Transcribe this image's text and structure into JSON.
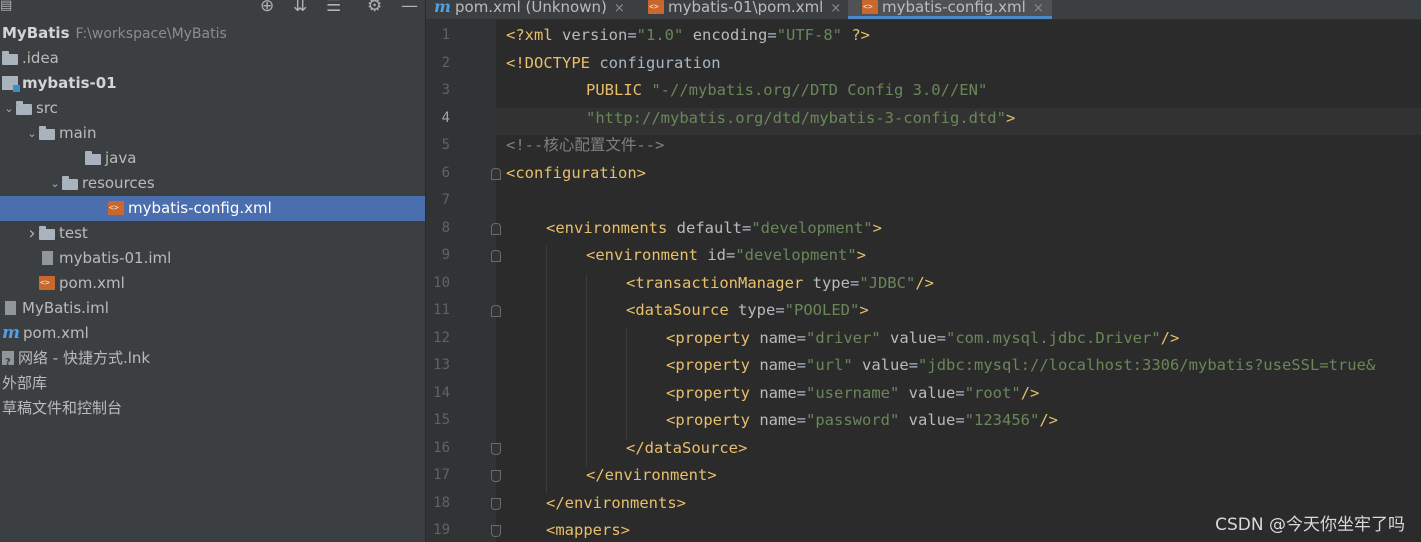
{
  "sidebar": {
    "toolbar_icons": [
      "locate-icon",
      "expand-all-icon",
      "collapse-all-icon",
      "gear-icon",
      "minimize-icon"
    ],
    "tree": [
      {
        "label": "MyBatis",
        "path": "F:\\workspace\\MyBatis",
        "icon": "none",
        "depth": 0,
        "arrow": "",
        "bold": true
      },
      {
        "label": ".idea",
        "icon": "folder",
        "depth": 0,
        "arrow": ""
      },
      {
        "label": "mybatis-01",
        "icon": "module",
        "depth": 0,
        "arrow": "",
        "bold": true
      },
      {
        "label": "src",
        "icon": "folder",
        "depth": 0,
        "arrow": "down"
      },
      {
        "label": "main",
        "icon": "folder",
        "depth": 1,
        "arrow": "down"
      },
      {
        "label": "java",
        "icon": "folder",
        "depth": 3,
        "arrow": ""
      },
      {
        "label": "resources",
        "icon": "folder",
        "depth": 2,
        "arrow": "down"
      },
      {
        "label": "mybatis-config.xml",
        "icon": "xml",
        "depth": 4,
        "arrow": "",
        "selected": true
      },
      {
        "label": "test",
        "icon": "folder",
        "depth": 1,
        "arrow": "right"
      },
      {
        "label": "mybatis-01.iml",
        "icon": "file",
        "depth": 1,
        "arrow": ""
      },
      {
        "label": "pom.xml",
        "icon": "xml",
        "depth": 1,
        "arrow": ""
      },
      {
        "label": "MyBatis.iml",
        "icon": "file",
        "depth": 0,
        "arrow": ""
      },
      {
        "label": "pom.xml",
        "icon": "maven",
        "depth": 0,
        "arrow": ""
      },
      {
        "label": "网络 - 快捷方式.lnk",
        "icon": "link",
        "depth": 0,
        "arrow": ""
      },
      {
        "label": "外部库",
        "icon": "none",
        "depth": 0,
        "arrow": ""
      },
      {
        "label": "草稿文件和控制台",
        "icon": "none",
        "depth": 0,
        "arrow": ""
      }
    ]
  },
  "tabs": [
    {
      "label": "pom.xml (Unknown)",
      "icon": "maven",
      "active": false,
      "close": "×"
    },
    {
      "label": "mybatis-01\\pom.xml",
      "icon": "xml",
      "active": false,
      "close": "×"
    },
    {
      "label": "mybatis-config.xml",
      "icon": "xml",
      "active": true,
      "close": "×"
    }
  ],
  "editor": {
    "current_line": 4,
    "lines": [
      {
        "n": 1,
        "indent": 0,
        "tokens": [
          [
            "t",
            "<?xml "
          ],
          [
            "a",
            "version"
          ],
          [
            "p",
            "="
          ],
          [
            "v",
            "\"1.0\""
          ],
          [
            "p",
            " "
          ],
          [
            "a",
            "encoding"
          ],
          [
            "p",
            "="
          ],
          [
            "v",
            "\"UTF-8\""
          ],
          [
            "t",
            " ?>"
          ]
        ]
      },
      {
        "n": 2,
        "indent": 0,
        "tokens": [
          [
            "t",
            "<!DOCTYPE "
          ],
          [
            "p",
            "configuration"
          ]
        ]
      },
      {
        "n": 3,
        "indent": 8,
        "tokens": [
          [
            "t",
            "PUBLIC "
          ],
          [
            "v",
            "\"-//mybatis.org//DTD Config 3.0//EN\""
          ]
        ]
      },
      {
        "n": 4,
        "indent": 8,
        "tokens": [
          [
            "v",
            "\"http://mybatis.org/dtd/mybatis-3-config.dtd\""
          ],
          [
            "t",
            ">"
          ]
        ]
      },
      {
        "n": 5,
        "indent": 0,
        "tokens": [
          [
            "c",
            "<!--核心配置文件-->"
          ]
        ]
      },
      {
        "n": 6,
        "indent": 0,
        "tokens": [
          [
            "t",
            "<configuration>"
          ]
        ]
      },
      {
        "n": 7,
        "indent": 0,
        "tokens": []
      },
      {
        "n": 8,
        "indent": 4,
        "tokens": [
          [
            "t",
            "<environments "
          ],
          [
            "a",
            "default"
          ],
          [
            "p",
            "="
          ],
          [
            "v",
            "\"development\""
          ],
          [
            "t",
            ">"
          ]
        ]
      },
      {
        "n": 9,
        "indent": 8,
        "tokens": [
          [
            "t",
            "<environment "
          ],
          [
            "a",
            "id"
          ],
          [
            "p",
            "="
          ],
          [
            "v",
            "\"development\""
          ],
          [
            "t",
            ">"
          ]
        ]
      },
      {
        "n": 10,
        "indent": 12,
        "tokens": [
          [
            "t",
            "<transactionManager "
          ],
          [
            "a",
            "type"
          ],
          [
            "p",
            "="
          ],
          [
            "v",
            "\"JDBC\""
          ],
          [
            "t",
            "/>"
          ]
        ]
      },
      {
        "n": 11,
        "indent": 12,
        "tokens": [
          [
            "t",
            "<dataSource "
          ],
          [
            "a",
            "type"
          ],
          [
            "p",
            "="
          ],
          [
            "v",
            "\"POOLED\""
          ],
          [
            "t",
            ">"
          ]
        ]
      },
      {
        "n": 12,
        "indent": 16,
        "tokens": [
          [
            "t",
            "<property "
          ],
          [
            "a",
            "name"
          ],
          [
            "p",
            "="
          ],
          [
            "v",
            "\"driver\""
          ],
          [
            "p",
            " "
          ],
          [
            "a",
            "value"
          ],
          [
            "p",
            "="
          ],
          [
            "v",
            "\"com.mysql.jdbc.Driver\""
          ],
          [
            "t",
            "/>"
          ]
        ]
      },
      {
        "n": 13,
        "indent": 16,
        "tokens": [
          [
            "t",
            "<property "
          ],
          [
            "a",
            "name"
          ],
          [
            "p",
            "="
          ],
          [
            "v",
            "\"url\""
          ],
          [
            "p",
            " "
          ],
          [
            "a",
            "value"
          ],
          [
            "p",
            "="
          ],
          [
            "v",
            "\"jdbc:mysql://localhost:3306/mybatis?useSSL=true&"
          ]
        ]
      },
      {
        "n": 14,
        "indent": 16,
        "tokens": [
          [
            "t",
            "<property "
          ],
          [
            "a",
            "name"
          ],
          [
            "p",
            "="
          ],
          [
            "v",
            "\"username\""
          ],
          [
            "p",
            " "
          ],
          [
            "a",
            "value"
          ],
          [
            "p",
            "="
          ],
          [
            "v",
            "\"root\""
          ],
          [
            "t",
            "/>"
          ]
        ]
      },
      {
        "n": 15,
        "indent": 16,
        "tokens": [
          [
            "t",
            "<property "
          ],
          [
            "a",
            "name"
          ],
          [
            "p",
            "="
          ],
          [
            "v",
            "\"password\""
          ],
          [
            "p",
            " "
          ],
          [
            "a",
            "value"
          ],
          [
            "p",
            "="
          ],
          [
            "v",
            "\"123456\""
          ],
          [
            "t",
            "/>"
          ]
        ]
      },
      {
        "n": 16,
        "indent": 12,
        "tokens": [
          [
            "t",
            "</dataSource>"
          ]
        ]
      },
      {
        "n": 17,
        "indent": 8,
        "tokens": [
          [
            "t",
            "</environment>"
          ]
        ]
      },
      {
        "n": 18,
        "indent": 4,
        "tokens": [
          [
            "t",
            "</environments>"
          ]
        ]
      },
      {
        "n": 19,
        "indent": 4,
        "tokens": [
          [
            "t",
            "<mappers>"
          ]
        ]
      }
    ]
  },
  "watermark": "CSDN @今天你坐牢了吗"
}
